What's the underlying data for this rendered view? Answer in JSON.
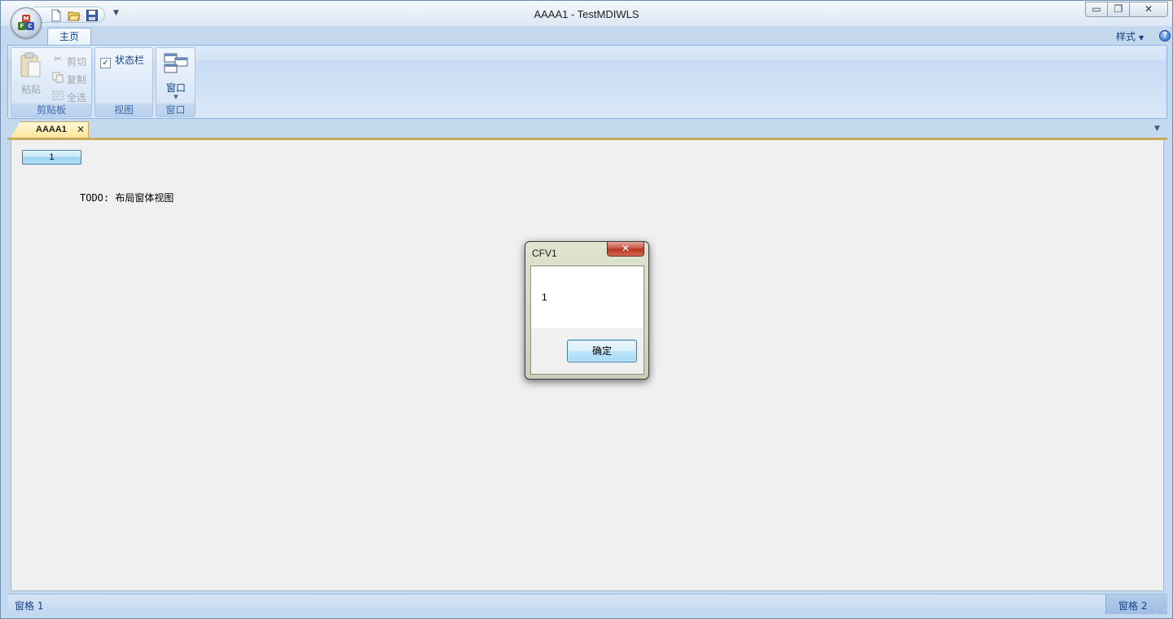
{
  "window": {
    "title": "AAAA1 - TestMDIWLS"
  },
  "ribbon": {
    "tabs": [
      {
        "label": "主页"
      }
    ],
    "style_menu": "样式",
    "help_icon": "help-icon",
    "groups": {
      "clipboard": {
        "label": "剪贴板",
        "paste": "粘贴",
        "cut": "剪切",
        "copy": "复制",
        "select_all": "全选"
      },
      "view": {
        "label": "视图",
        "status_bar_checkbox": "状态栏",
        "status_bar_checked": true
      },
      "window": {
        "label": "窗口",
        "window_button": "窗口"
      }
    }
  },
  "mdi": {
    "active_tab": "AAAA1",
    "tab_color": "#ffe69a"
  },
  "document": {
    "button_label": "1",
    "todo_text": "TODO: 布局窗体视图"
  },
  "dialog": {
    "title": "CFV1",
    "message": "1",
    "ok_label": "确定"
  },
  "statusbar": {
    "pane1": "窗格 1",
    "pane2": "窗格 2"
  },
  "colors": {
    "ribbon_text": "#15428b",
    "frame": "#c4daf2",
    "close_red": "#c8503d"
  }
}
